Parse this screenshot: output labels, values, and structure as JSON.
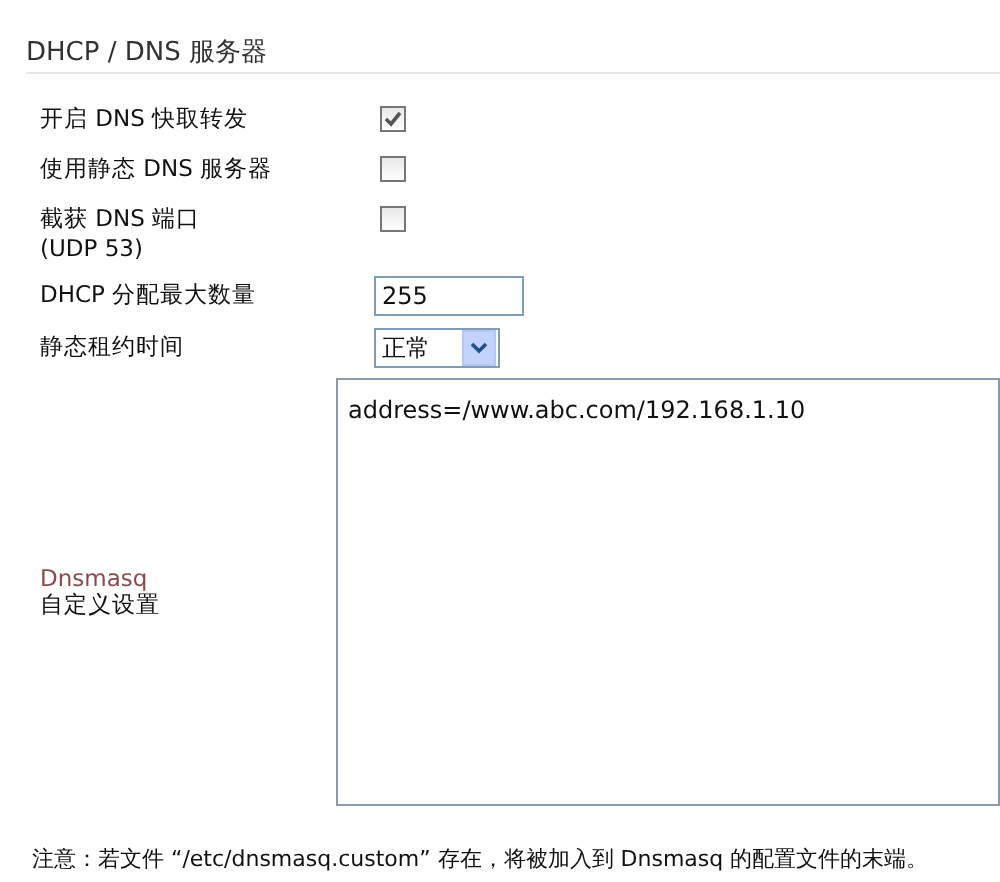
{
  "section_title": "DHCP / DNS 服务器",
  "settings": [
    {
      "kind": "checkbox",
      "label": "开启  DNS 快取转发",
      "checked": true
    },
    {
      "kind": "checkbox",
      "label": "使用静态  DNS 服务器",
      "checked": false
    },
    {
      "kind": "checkbox",
      "label": "截获  DNS 端口\n(UDP 53)",
      "checked": false
    },
    {
      "kind": "text",
      "label": "DHCP 分配最大数量",
      "value": "255"
    },
    {
      "kind": "select",
      "label": "静态租约时间",
      "value": "正常"
    }
  ],
  "custom_config": {
    "label_link": "Dnsmasq",
    "label": "自定义设置",
    "value": "address=/www.abc.com/192.168.1.10"
  },
  "note": "注意：若文件 “/etc/dnsmasq.custom” 存在，将被加入到  Dnsmasq 的配置文件的末端。"
}
